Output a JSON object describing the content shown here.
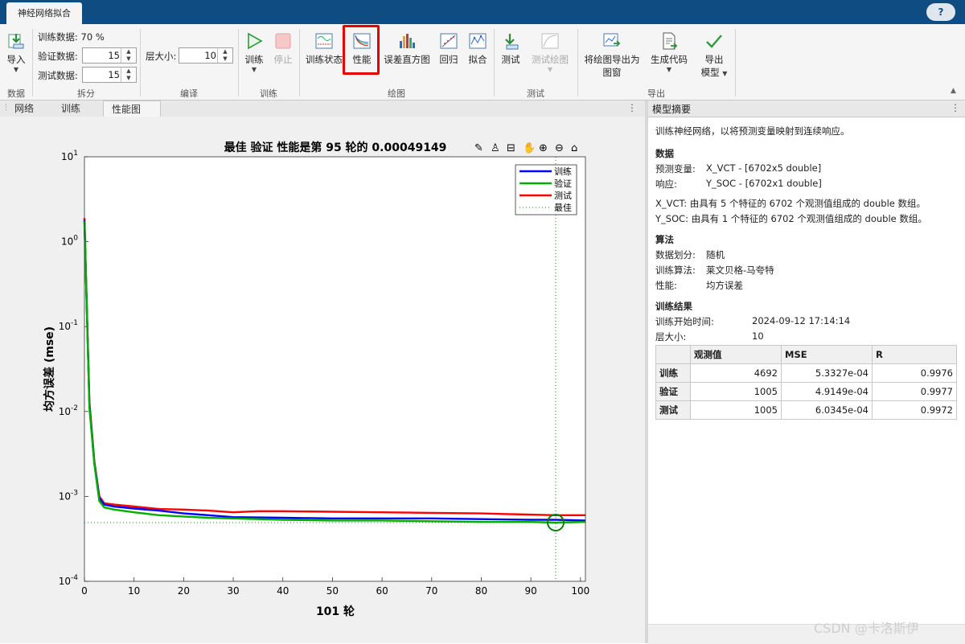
{
  "app": {
    "title_tab": "神经网络拟合",
    "help_label": "?"
  },
  "ribbon": {
    "import": {
      "label": "导入"
    },
    "data_section": "数据",
    "split": {
      "train_data": "训练数据: 70 %",
      "val_label": "验证数据:",
      "val_value": "15",
      "test_label": "测试数据:",
      "test_value": "15",
      "section": "拆分"
    },
    "compile": {
      "layer_label": "层大小:",
      "layer_value": "10",
      "section": "编译"
    },
    "train": {
      "train_label": "训练",
      "stop_label": "停止",
      "section": "训练"
    },
    "plots": {
      "items": [
        "训练状态",
        "性能",
        "误差直方图",
        "回归",
        "拟合"
      ],
      "section": "绘图"
    },
    "test": {
      "test_label": "测试",
      "test_plot_label": "测试绘图",
      "section": "测试"
    },
    "export": {
      "export_fig_line1": "将绘图导出为",
      "export_fig_line2": "图窗",
      "gen_code": "生成代码",
      "export_model_line1": "导出",
      "export_model_line2": "模型",
      "section": "导出"
    },
    "colors": {
      "accent": "#0f4c81",
      "highlight": "#e60000"
    }
  },
  "tabs": [
    "网络",
    "训练",
    "性能图"
  ],
  "plot": {
    "title": "最佳 验证 性能是第 95 轮的 0.00049149",
    "ylabel": "均方误差 (mse)",
    "xlabel": "101 轮",
    "legend": [
      "训练",
      "验证",
      "测试",
      "最佳"
    ]
  },
  "chart_data": {
    "type": "line",
    "title": "最佳 验证 性能是第 95 轮的 0.00049149",
    "xlabel": "101 轮",
    "ylabel": "均方误差 (mse)",
    "xlim": [
      0,
      101
    ],
    "ylim": [
      0.0001,
      10
    ],
    "yscale": "log",
    "x_ticks": [
      0,
      10,
      20,
      30,
      40,
      50,
      60,
      70,
      80,
      90,
      100
    ],
    "y_ticks": [
      "10^-4",
      "10^-3",
      "10^-2",
      "10^-1",
      "10^0",
      "10^1"
    ],
    "series": [
      {
        "name": "训练",
        "color": "#0000ff",
        "x": [
          0,
          1,
          2,
          3,
          4,
          6,
          10,
          15,
          20,
          25,
          30,
          40,
          50,
          60,
          70,
          80,
          90,
          95,
          101
        ],
        "values": [
          1.8,
          0.012,
          0.0025,
          0.00095,
          0.0008,
          0.00076,
          0.00072,
          0.00068,
          0.00063,
          0.0006,
          0.00057,
          0.00056,
          0.00055,
          0.00055,
          0.00055,
          0.00054,
          0.00053,
          0.00053,
          0.00052
        ]
      },
      {
        "name": "验证",
        "color": "#00b000",
        "x": [
          0,
          1,
          2,
          3,
          4,
          6,
          10,
          15,
          20,
          25,
          30,
          40,
          50,
          60,
          70,
          80,
          90,
          95,
          101
        ],
        "values": [
          1.75,
          0.011,
          0.0024,
          0.00088,
          0.00074,
          0.0007,
          0.00065,
          0.0006,
          0.00058,
          0.00056,
          0.00055,
          0.00053,
          0.00052,
          0.00052,
          0.00051,
          0.0005,
          0.0005,
          0.00049149,
          0.0005
        ]
      },
      {
        "name": "测试",
        "color": "#ff0000",
        "x": [
          0,
          1,
          2,
          3,
          4,
          6,
          10,
          15,
          20,
          25,
          30,
          35,
          40,
          50,
          60,
          70,
          80,
          90,
          95,
          101
        ],
        "values": [
          1.9,
          0.013,
          0.0026,
          0.001,
          0.00083,
          0.0008,
          0.00076,
          0.00071,
          0.0007,
          0.00068,
          0.00065,
          0.00067,
          0.00067,
          0.00066,
          0.00065,
          0.00064,
          0.00063,
          0.00061,
          0.0006,
          0.0006
        ]
      }
    ],
    "best": {
      "name": "最佳",
      "epoch": 95,
      "value": 0.00049149
    },
    "legend_position": "top-right",
    "grid": false
  },
  "summary": {
    "header": "模型摘要",
    "intro": "训练神经网络，以将预测变量映射到连续响应。",
    "data_title": "数据",
    "predictor_label": "预测变量:",
    "predictor_value": "X_VCT - [6702x5 double]",
    "response_label": "响应:",
    "response_value": "Y_SOC - [6702x1 double]",
    "x_desc": "X_VCT: 由具有 5 个特征的 6702 个观测值组成的 double 数组。",
    "y_desc": "Y_SOC: 由具有 1 个特征的 6702 个观测值组成的 double 数组。",
    "algo_title": "算法",
    "split_label": "数据划分:",
    "split_value": "随机",
    "train_algo_label": "训练算法:",
    "train_algo_value": "莱文贝格-马夸特",
    "perf_label": "性能:",
    "perf_value": "均方误差",
    "result_title": "训练结果",
    "start_label": "训练开始时间:",
    "start_value": "2024-09-12 17:14:14",
    "layer_label": "层大小:",
    "layer_value": "10",
    "table": {
      "headers": [
        "",
        "观测值",
        "MSE",
        "R"
      ],
      "rows": [
        [
          "训练",
          "4692",
          "5.3327e-04",
          "0.9976"
        ],
        [
          "验证",
          "1005",
          "4.9149e-04",
          "0.9977"
        ],
        [
          "测试",
          "1005",
          "6.0345e-04",
          "0.9972"
        ]
      ]
    }
  },
  "watermark": "CSDN @卡洛斯伊"
}
